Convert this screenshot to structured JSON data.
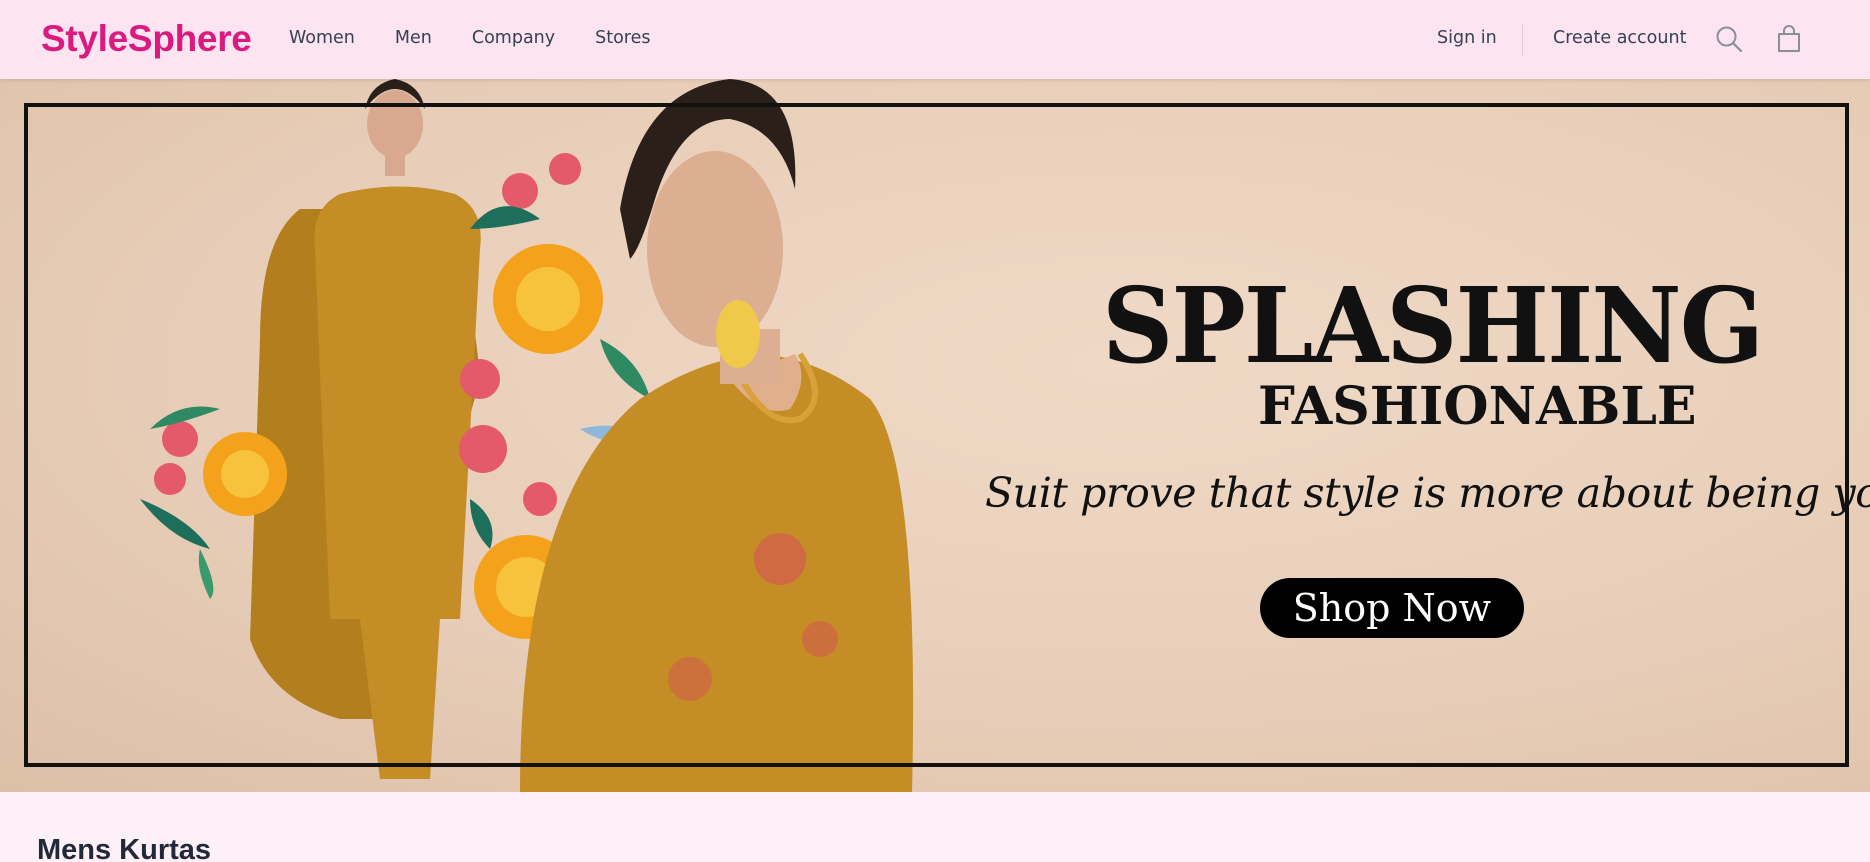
{
  "brand": {
    "name": "StyleSphere",
    "color": "#db1a80"
  },
  "nav": {
    "links": [
      "Women",
      "Men",
      "Company",
      "Stores"
    ],
    "sign_in": "Sign in",
    "create_account": "Create account",
    "icons": [
      "search-icon",
      "shopping-bag-icon"
    ]
  },
  "hero": {
    "title": "SPLASHING",
    "subtitle": "FASHIONABLE",
    "tagline": "Suit prove that style is more about being yourself.",
    "cta": "Shop Now"
  },
  "section": {
    "title": "Mens Kurtas"
  },
  "colors": {
    "header_bg": "#fce4f1",
    "page_bg": "#fdf0f6",
    "hero_bg": "#e8ceb9",
    "text": "#374151"
  }
}
